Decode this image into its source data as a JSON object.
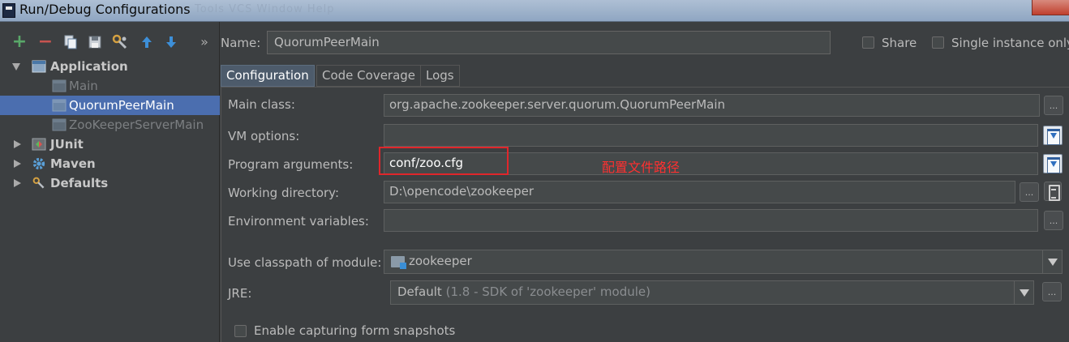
{
  "window": {
    "title": "Run/Debug Configurations",
    "background_menu": "Tools  VCS  Window  Help"
  },
  "toolbar": {
    "add": "+",
    "remove": "−",
    "more": "»"
  },
  "tree": {
    "application": "Application",
    "main": "Main",
    "quorum": "QuorumPeerMain",
    "zkserver": "ZooKeeperServerMain",
    "junit": "JUnit",
    "maven": "Maven",
    "defaults": "Defaults"
  },
  "header": {
    "name_label": "Name:",
    "name_value": "QuorumPeerMain",
    "share_label": "Share",
    "single_instance_label": "Single instance only"
  },
  "tabs": {
    "configuration": "Configuration",
    "code_coverage": "Code Coverage",
    "logs": "Logs"
  },
  "form": {
    "main_class_label": "Main class:",
    "main_class_value": "org.apache.zookeeper.server.quorum.QuorumPeerMain",
    "vm_options_label": "VM options:",
    "vm_options_value": "",
    "program_args_label": "Program arguments:",
    "program_args_value": "conf/zoo.cfg",
    "working_dir_label": "Working directory:",
    "working_dir_value": "D:\\opencode\\zookeeper",
    "env_vars_label": "Environment variables:",
    "env_vars_value": "",
    "classpath_label": "Use classpath of module:",
    "classpath_value": "zookeeper",
    "jre_label": "JRE:",
    "jre_value": "Default",
    "jre_detail": "(1.8 - SDK of 'zookeeper' module)",
    "snapshots_label": "Enable capturing form snapshots",
    "ellipsis": "..."
  },
  "annotation": {
    "text": "配置文件路径",
    "color": "#ff3030"
  },
  "colors": {
    "selection": "#4b6eaf",
    "background": "#3c3f41",
    "add_green": "#59a869",
    "remove_red": "#c75450",
    "arrow_blue": "#3d8fd8"
  }
}
